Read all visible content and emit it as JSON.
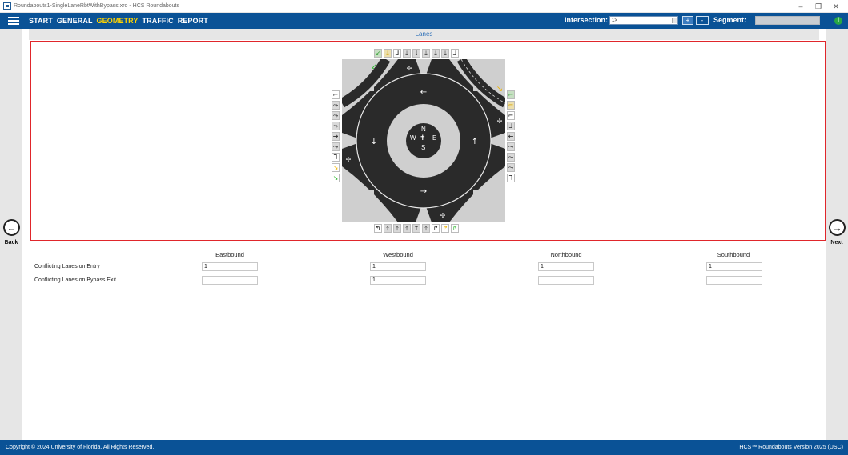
{
  "window": {
    "title": "Roundabouts1-SingleLaneRbtWithBypass.xro - HCS Roundabouts",
    "controls": [
      "–",
      "❐",
      "✕"
    ]
  },
  "menu": {
    "items": [
      {
        "label": "START",
        "active": false
      },
      {
        "label": "GENERAL",
        "active": false
      },
      {
        "label": "GEOMETRY",
        "active": true
      },
      {
        "label": "TRAFFIC",
        "active": false
      },
      {
        "label": "REPORT",
        "active": false
      }
    ],
    "intersection_label": "Intersection:",
    "intersection_value": "1>",
    "add_label": "+",
    "remove_label": "-",
    "segment_label": "Segment:",
    "info_label": "i"
  },
  "nav": {
    "back_label": "Back",
    "next_label": "Next",
    "back_icon": "←",
    "next_icon": "→"
  },
  "section": {
    "title": "Lanes"
  },
  "compass": {
    "n": "N",
    "s": "S",
    "e": "E",
    "w": "W"
  },
  "lane_buttons": {
    "top": [
      "↙",
      "⤓",
      "⅃",
      "⤓",
      "↓",
      "⤓",
      "⤓",
      "⤓",
      "⅃"
    ],
    "left": [
      "⌐",
      "⤳",
      "⤳",
      "⤳",
      "→",
      "⤳",
      "⅂",
      "↘",
      "↘"
    ],
    "right": [
      "⌐",
      "⌐",
      "⌐",
      "⅃",
      "←",
      "⤳",
      "⤳",
      "⤳",
      "⅂"
    ],
    "bottom": [
      "↰",
      "⤒",
      "⤒",
      "⤒",
      "↑",
      "⤒",
      "↱",
      "↱",
      "↱"
    ]
  },
  "table": {
    "columns": [
      "Eastbound",
      "Westbound",
      "Northbound",
      "Southbound"
    ],
    "rows": [
      {
        "label": "Conflicting Lanes on Entry",
        "values": [
          "1",
          "1",
          "1",
          "1"
        ]
      },
      {
        "label": "Conflicting Lanes on Bypass Exit",
        "values": [
          "",
          "1",
          "",
          ""
        ]
      }
    ]
  },
  "footer": {
    "copyright": "Copyright © 2024 University of Florida. All Rights Reserved.",
    "version": "HCS™ Roundabouts Version 2025 (USC)"
  },
  "colors": {
    "brand": "#0a5296",
    "active_menu": "#ffd400",
    "panel_border": "#e0262b",
    "section_title": "#2d6fb7"
  }
}
